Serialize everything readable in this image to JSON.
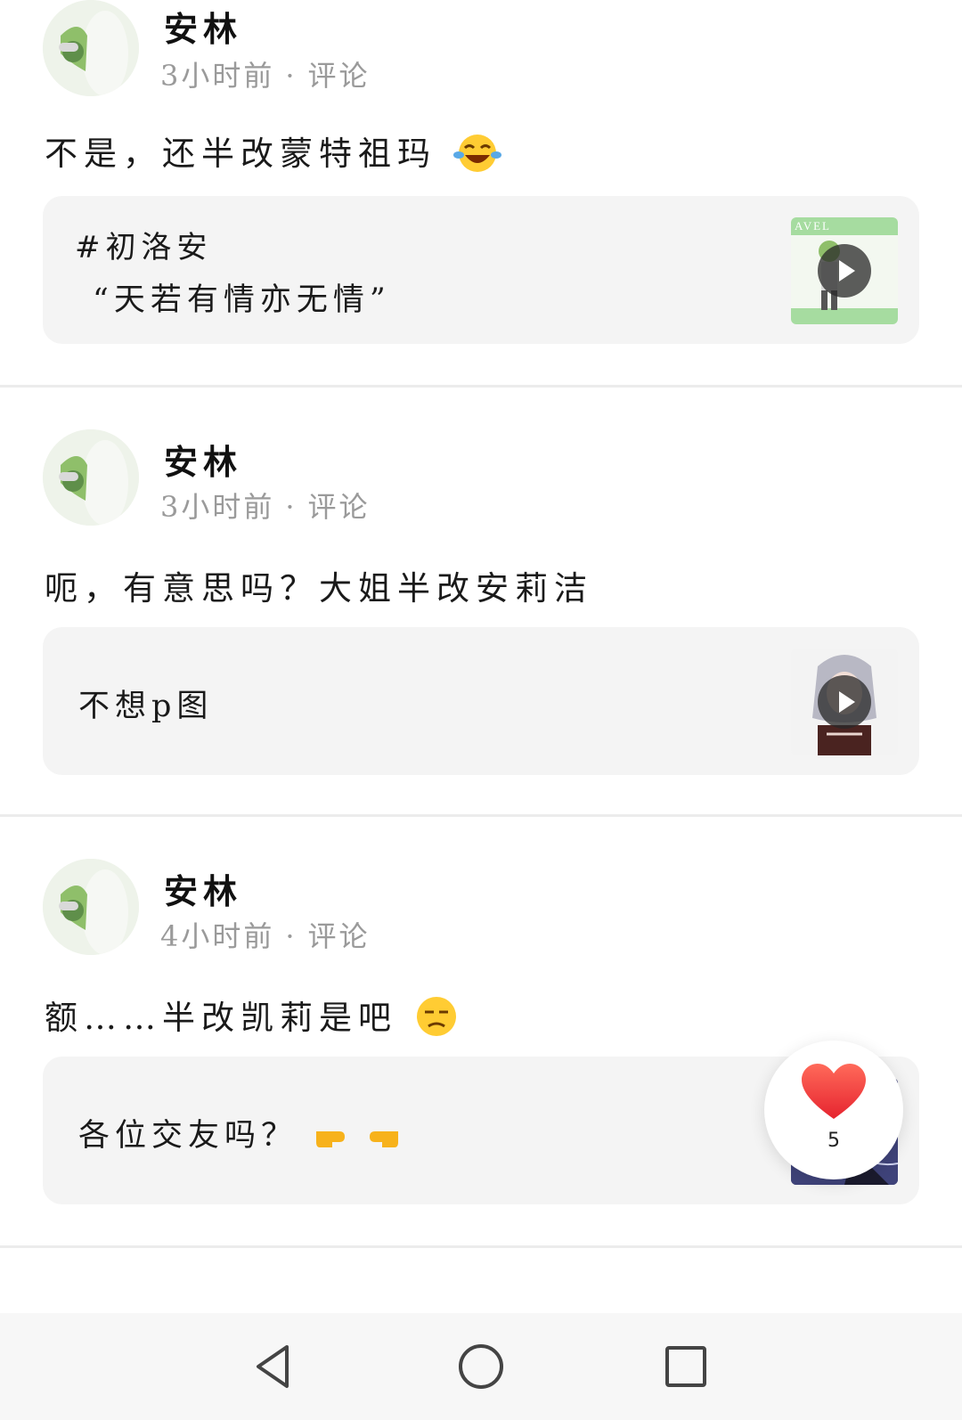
{
  "posts": [
    {
      "username": "安林",
      "time": "3小时前",
      "action": "评论",
      "text": "不是，还半改蒙特祖玛",
      "emoji": "laughing-tears",
      "card": {
        "lines": [
          "#初洛安",
          "“天若有情亦无情”"
        ],
        "has_video": true,
        "thumb_overlay_text": "AVEL"
      }
    },
    {
      "username": "安林",
      "time": "3小时前",
      "action": "评论",
      "text": "呃，有意思吗？大姐半改安莉洁",
      "emoji": "",
      "card": {
        "lines": [
          "不想p图"
        ],
        "has_video": true
      }
    },
    {
      "username": "安林",
      "time": "4小时前",
      "action": "评论",
      "text": "额……半改凯莉是吧",
      "emoji": "unamused-face",
      "card": {
        "lines": [
          "各位交友吗？"
        ],
        "has_video": false,
        "emoji": "pointing-hands"
      }
    }
  ],
  "like_button": {
    "count": "5",
    "icon": "heart-icon",
    "color": "#f23a3a"
  },
  "nav": {
    "back": "back-triangle-icon",
    "home": "home-circle-icon",
    "recents": "recents-square-icon"
  },
  "colors": {
    "card_bg": "#f4f4f4",
    "meta_gray": "#9a9a9a",
    "divider": "#ececec"
  }
}
